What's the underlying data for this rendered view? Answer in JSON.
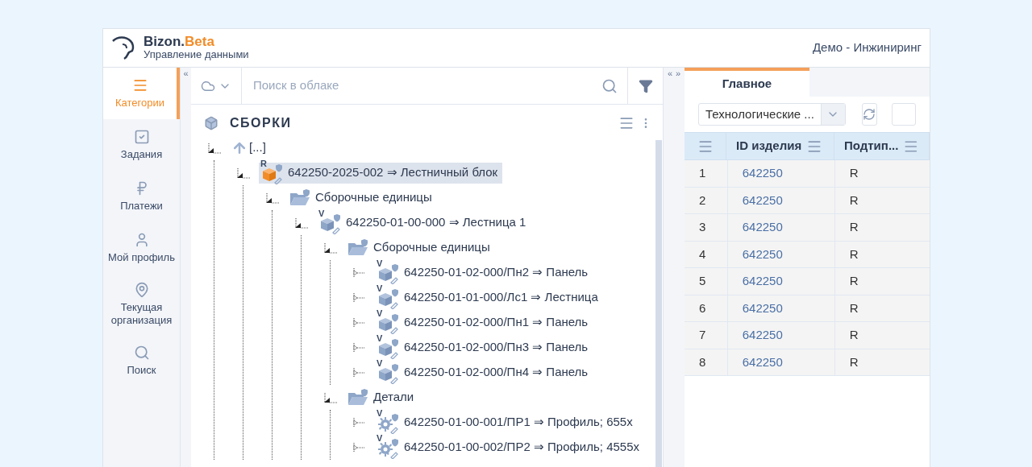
{
  "header": {
    "brand_name": "Bizon.",
    "brand_suffix": "Beta",
    "subtitle": "Управление данными",
    "organization": "Демо - Инжиниринг"
  },
  "sidebar": {
    "items": [
      {
        "label": "Категории",
        "selected": true
      },
      {
        "label": "Задания",
        "selected": false
      },
      {
        "label": "Платежи",
        "selected": false
      },
      {
        "label": "Мой профиль",
        "selected": false
      },
      {
        "label": "Текущая организация",
        "selected": false
      },
      {
        "label": "Поиск",
        "selected": false
      }
    ]
  },
  "collapse_left": "«",
  "collapse_middle": [
    "«",
    "»"
  ],
  "search": {
    "placeholder": "Поиск в облаке"
  },
  "tree": {
    "title": "СБОРКИ",
    "items": [
      {
        "kind": "up",
        "label": "[...]",
        "expanded": true,
        "selected": false,
        "children": [
          {
            "kind": "assembly",
            "badge": "R",
            "label": "642250-2025-002 ⇒ Лестничный блок",
            "expanded": true,
            "selected": true,
            "children": [
              {
                "kind": "folder",
                "label": "Сборочные единицы",
                "expanded": true,
                "selected": false,
                "children": [
                  {
                    "kind": "assembly",
                    "badge": "V",
                    "label": "642250-01-00-000 ⇒ Лестница 1",
                    "expanded": true,
                    "selected": false,
                    "children": [
                      {
                        "kind": "folder",
                        "label": "Сборочные единицы",
                        "expanded": true,
                        "selected": false,
                        "children": [
                          {
                            "kind": "assembly",
                            "badge": "V",
                            "label": "642250-01-02-000/Пн2 ⇒ Панель",
                            "expanded": false,
                            "selected": false
                          },
                          {
                            "kind": "assembly",
                            "badge": "V",
                            "label": "642250-01-01-000/Лс1 ⇒ Лестница",
                            "expanded": false,
                            "selected": false
                          },
                          {
                            "kind": "assembly",
                            "badge": "V",
                            "label": "642250-01-02-000/Пн1 ⇒ Панель",
                            "expanded": false,
                            "selected": false
                          },
                          {
                            "kind": "assembly",
                            "badge": "V",
                            "label": "642250-01-02-000/Пн3 ⇒ Панель",
                            "expanded": false,
                            "selected": false
                          },
                          {
                            "kind": "assembly",
                            "badge": "V",
                            "label": "642250-01-02-000/Пн4 ⇒ Панель",
                            "expanded": false,
                            "selected": false
                          }
                        ]
                      },
                      {
                        "kind": "folder",
                        "label": "Детали",
                        "expanded": true,
                        "selected": false,
                        "children": [
                          {
                            "kind": "part",
                            "badge": "V",
                            "label": "642250-01-00-001/ПР1 ⇒ Профиль; 655x",
                            "selected": false
                          },
                          {
                            "kind": "part",
                            "badge": "V",
                            "label": "642250-01-00-002/ПР2 ⇒ Профиль; 4555x",
                            "selected": false
                          }
                        ]
                      }
                    ]
                  }
                ]
              }
            ]
          }
        ]
      }
    ]
  },
  "details": {
    "tabs": [
      {
        "label": "Главное",
        "selected": true
      }
    ],
    "view_select": {
      "value": "Технологические ..."
    },
    "table": {
      "columns": [
        "ID изделия",
        "Подтип..."
      ],
      "rows": [
        {
          "number": "1",
          "id": "642250",
          "subtype": "R"
        },
        {
          "number": "2",
          "id": "642250",
          "subtype": "R"
        },
        {
          "number": "3",
          "id": "642250",
          "subtype": "R"
        },
        {
          "number": "4",
          "id": "642250",
          "subtype": "R"
        },
        {
          "number": "5",
          "id": "642250",
          "subtype": "R"
        },
        {
          "number": "6",
          "id": "642250",
          "subtype": "R"
        },
        {
          "number": "7",
          "id": "642250",
          "subtype": "R"
        },
        {
          "number": "8",
          "id": "642250",
          "subtype": "R"
        }
      ]
    }
  }
}
